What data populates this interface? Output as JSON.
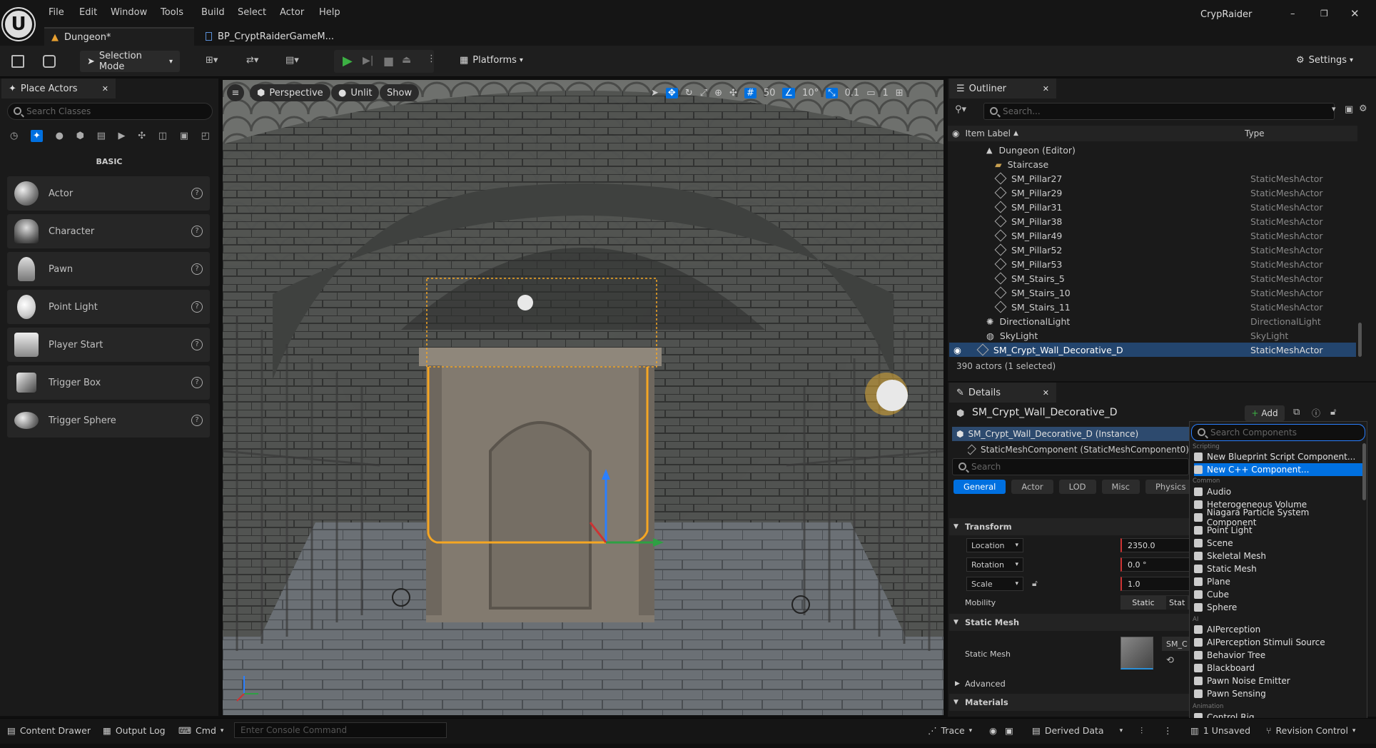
{
  "window": {
    "title": "CrypRaider"
  },
  "menu": [
    "File",
    "Edit",
    "Window",
    "Tools",
    "Build",
    "Select",
    "Actor",
    "Help"
  ],
  "doc_tabs": [
    {
      "label": "Dungeon*",
      "active": true
    },
    {
      "label": "BP_CryptRaiderGameM..."
    }
  ],
  "toolbar": {
    "selection_mode": "Selection Mode",
    "platforms": "Platforms",
    "settings": "Settings"
  },
  "place_actors": {
    "tab": "Place Actors",
    "search_placeholder": "Search Classes",
    "category": "BASIC",
    "items": [
      "Actor",
      "Character",
      "Pawn",
      "Point Light",
      "Player Start",
      "Trigger Box",
      "Trigger Sphere"
    ]
  },
  "viewport": {
    "perspective": "Perspective",
    "lit_mode": "Unlit",
    "show": "Show",
    "grid_snap": "50",
    "rot_snap": "10°",
    "scale_snap": "0.1",
    "camera_speed": "1"
  },
  "outliner": {
    "tab": "Outliner",
    "search_placeholder": "Search...",
    "col_label": "Item Label",
    "col_type": "Type",
    "root": "Dungeon (Editor)",
    "folder": "Staircase",
    "rows": [
      {
        "label": "SM_Pillar27",
        "type": "StaticMeshActor"
      },
      {
        "label": "SM_Pillar29",
        "type": "StaticMeshActor"
      },
      {
        "label": "SM_Pillar31",
        "type": "StaticMeshActor"
      },
      {
        "label": "SM_Pillar38",
        "type": "StaticMeshActor"
      },
      {
        "label": "SM_Pillar49",
        "type": "StaticMeshActor"
      },
      {
        "label": "SM_Pillar52",
        "type": "StaticMeshActor"
      },
      {
        "label": "SM_Pillar53",
        "type": "StaticMeshActor"
      },
      {
        "label": "SM_Stairs_5",
        "type": "StaticMeshActor"
      },
      {
        "label": "SM_Stairs_10",
        "type": "StaticMeshActor"
      },
      {
        "label": "SM_Stairs_11",
        "type": "StaticMeshActor"
      }
    ],
    "directional": {
      "label": "DirectionalLight",
      "type": "DirectionalLight"
    },
    "skylight": {
      "label": "SkyLight",
      "type": "SkyLight"
    },
    "selected": {
      "label": "SM_Crypt_Wall_Decorative_D",
      "type": "StaticMeshActor"
    },
    "count": "390 actors (1 selected)"
  },
  "details": {
    "tab": "Details",
    "actor_name": "SM_Crypt_Wall_Decorative_D",
    "add": "Add",
    "instance": "SM_Crypt_Wall_Decorative_D (Instance)",
    "component": "StaticMeshComponent (StaticMeshComponent0)",
    "search_placeholder": "Search",
    "chips": [
      "General",
      "Actor",
      "LOD",
      "Misc",
      "Physics"
    ],
    "transform": "Transform",
    "location": "Location",
    "rotation": "Rotation",
    "scale": "Scale",
    "location_x": "2350.0",
    "rotation_x": "0.0 °",
    "scale_x": "1.0",
    "mobility": "Mobility",
    "mobility_static": "Static",
    "mobility_stat_cut": "Stat",
    "static_mesh_section": "Static Mesh",
    "static_mesh_label": "Static Mesh",
    "mesh_value_cut": "SM_C",
    "advanced": "Advanced",
    "materials": "Materials"
  },
  "components_dropdown": {
    "search_placeholder": "Search Components",
    "cat_scripting": "Scripting",
    "scripting": [
      "New Blueprint Script Component...",
      "New C++ Component..."
    ],
    "cat_common": "Common",
    "common": [
      "Audio",
      "Heterogeneous Volume",
      "Niagara Particle System Component",
      "Point Light",
      "Scene",
      "Skeletal Mesh",
      "Static Mesh",
      "Plane",
      "Cube",
      "Sphere"
    ],
    "cat_ai": "AI",
    "ai": [
      "AIPerception",
      "AIPerception Stimuli Source",
      "Behavior Tree",
      "Blackboard",
      "Pawn Noise Emitter",
      "Pawn Sensing"
    ],
    "cat_animation": "Animation",
    "animation": [
      "Control Rig"
    ]
  },
  "statusbar": {
    "content_drawer": "Content Drawer",
    "output_log": "Output Log",
    "cmd": "Cmd",
    "console_placeholder": "Enter Console Command",
    "trace": "Trace",
    "derived_data": "Derived Data",
    "unsaved": "1 Unsaved",
    "revision": "Revision Control"
  },
  "colors": {
    "accent": "#0070e0",
    "selection": "#f0a020",
    "play": "#3cb043"
  }
}
